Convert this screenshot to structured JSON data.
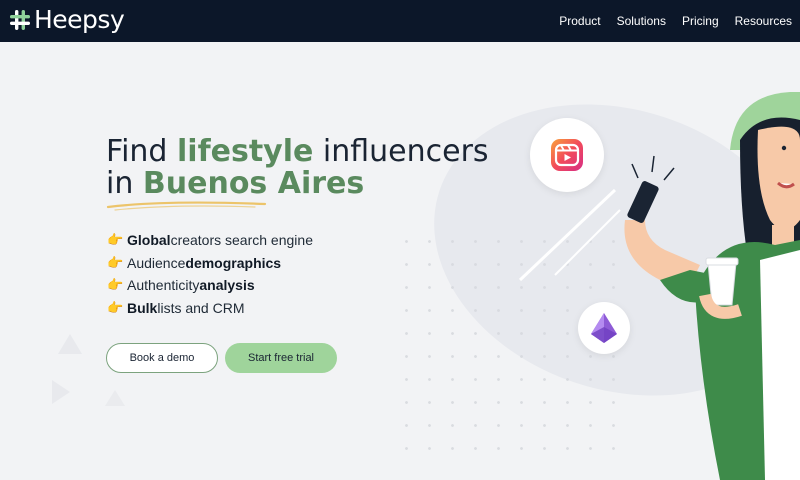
{
  "header": {
    "logo_text": "Heepsy",
    "nav": [
      "Product",
      "Solutions",
      "Pricing",
      "Resources"
    ]
  },
  "hero": {
    "headline_prefix": "Find ",
    "headline_accent_1": "lifestyle",
    "headline_mid": " influencers",
    "headline_line2_prefix": "in ",
    "headline_accent_2": "Buenos Aires",
    "features": [
      {
        "bold_first": true,
        "bold": "Global",
        "text": " creators search engine"
      },
      {
        "bold_first": false,
        "bold": "demographics",
        "text": "Audience "
      },
      {
        "bold_first": false,
        "bold": "analysis",
        "text": "Authenticity "
      },
      {
        "bold_first": true,
        "bold": "Bulk",
        "text": " lists and CRM"
      }
    ],
    "demo_button": "Book a demo",
    "trial_button": "Start free trial"
  },
  "colors": {
    "header_bg": "#0c1729",
    "accent_green": "#5a8a5e",
    "trial_button_bg": "#9fd49b",
    "page_bg": "#f2f3f5"
  },
  "icons": [
    "hashtag-logo-icon",
    "pointing-hand-icon",
    "instagram-reels-icon",
    "purple-gem-icon"
  ]
}
